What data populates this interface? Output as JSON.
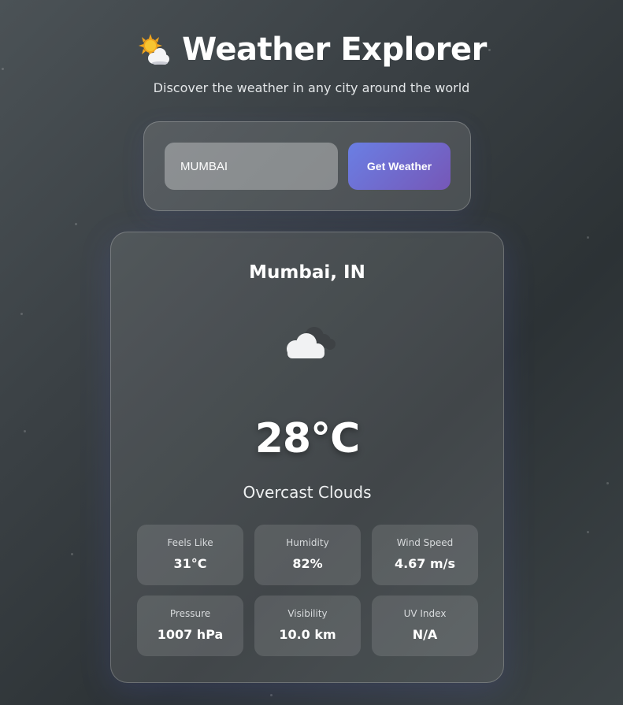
{
  "header": {
    "icon": "sun-behind-cloud-icon",
    "title": "Weather Explorer",
    "subtitle": "Discover the weather in any city around the world"
  },
  "search": {
    "value": "MUMBAI",
    "button_label": "Get Weather"
  },
  "weather": {
    "city": "Mumbai, IN",
    "icon": "cloud-icon",
    "temperature": "28°C",
    "description": "Overcast Clouds",
    "stats": [
      {
        "label": "Feels Like",
        "value": "31°C"
      },
      {
        "label": "Humidity",
        "value": "82%"
      },
      {
        "label": "Wind Speed",
        "value": "4.67 m/s"
      },
      {
        "label": "Pressure",
        "value": "1007 hPa"
      },
      {
        "label": "Visibility",
        "value": "10.0 km"
      },
      {
        "label": "UV Index",
        "value": "N/A"
      }
    ]
  },
  "colors": {
    "accent_start": "#6a7fe4",
    "accent_end": "#7657b7"
  }
}
